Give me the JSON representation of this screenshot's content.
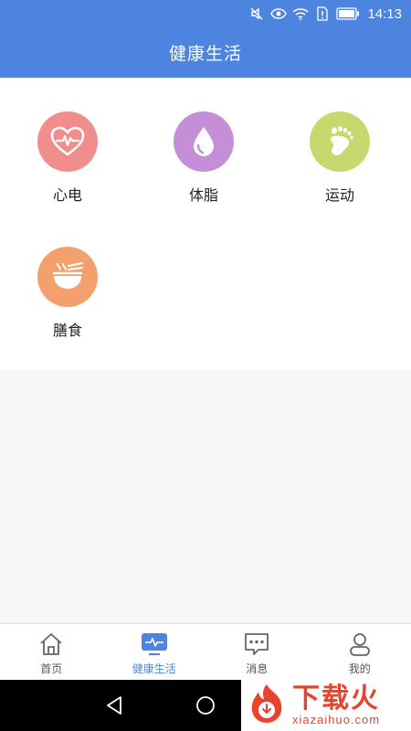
{
  "status_bar": {
    "time": "14:13",
    "icons": [
      "mute-icon",
      "eye-icon",
      "wifi-icon",
      "sim-alert-icon",
      "battery-icon"
    ]
  },
  "app_bar": {
    "title": "健康生活"
  },
  "features": [
    {
      "label": "心电",
      "icon": "heart-ecg-icon",
      "color": "#f08e8e"
    },
    {
      "label": "体脂",
      "icon": "water-drop-icon",
      "color": "#c48fd6"
    },
    {
      "label": "运动",
      "icon": "footprint-icon",
      "color": "#c9d86e"
    },
    {
      "label": "膳食",
      "icon": "noodle-bowl-icon",
      "color": "#f4a06c"
    }
  ],
  "tab_bar": {
    "active_index": 1,
    "tabs": [
      {
        "label": "首页",
        "icon": "home-icon"
      },
      {
        "label": "健康生活",
        "icon": "monitor-pulse-icon"
      },
      {
        "label": "消息",
        "icon": "message-icon"
      },
      {
        "label": "我的",
        "icon": "profile-icon"
      }
    ]
  },
  "watermark": {
    "title": "下载火",
    "subtitle": "xiazaihuo.com"
  },
  "colors": {
    "primary": "#4d84e0",
    "tab_inactive": "#555555"
  }
}
